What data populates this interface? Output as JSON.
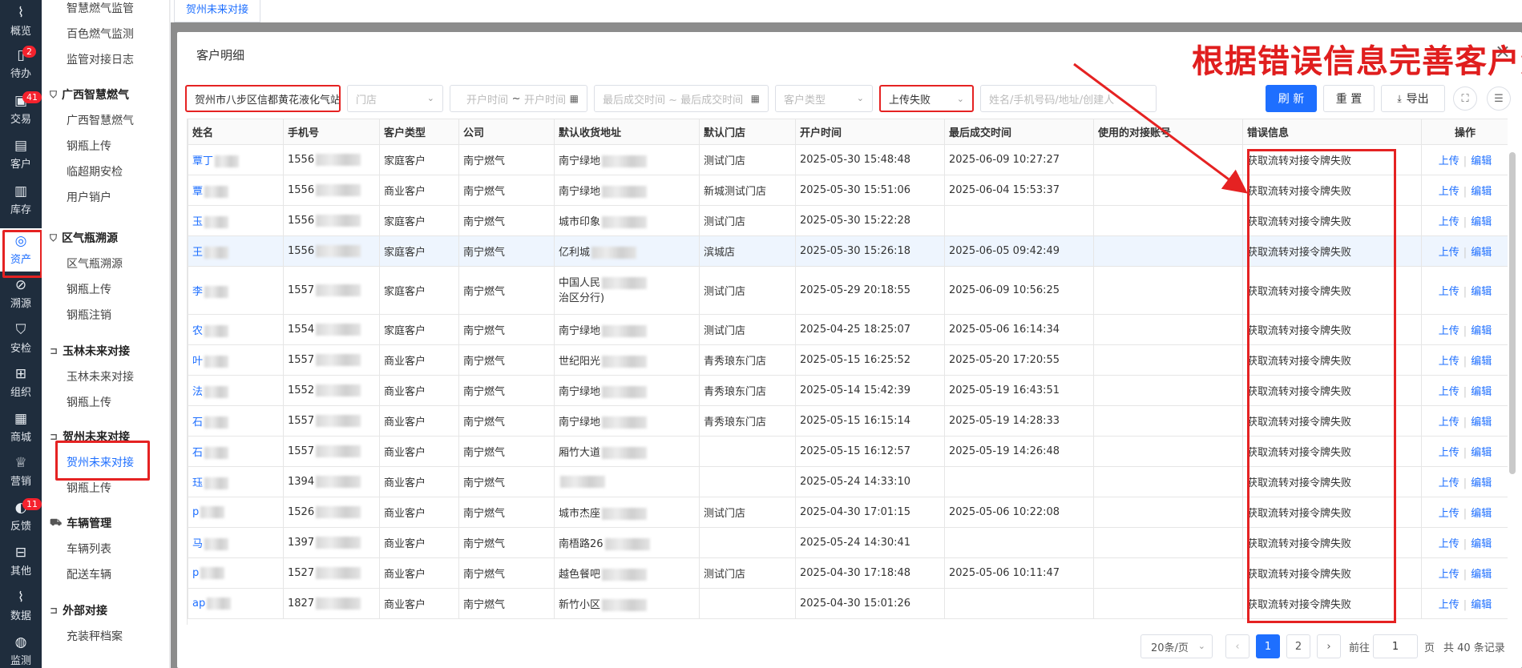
{
  "rail": [
    {
      "label": "概览",
      "icon": "chart-icon"
    },
    {
      "label": "待办",
      "icon": "todo-icon",
      "badge": "2"
    },
    {
      "label": "交易",
      "icon": "trade-icon",
      "badge": "41"
    },
    {
      "label": "客户",
      "icon": "customer-icon"
    },
    {
      "label": "库存",
      "icon": "inventory-icon"
    },
    {
      "label": "资产",
      "icon": "bulb-icon",
      "active": true
    },
    {
      "label": "溯源",
      "icon": "compass-icon"
    },
    {
      "label": "安检",
      "icon": "shield-icon"
    },
    {
      "label": "组织",
      "icon": "org-icon"
    },
    {
      "label": "商城",
      "icon": "shop-icon"
    },
    {
      "label": "营销",
      "icon": "trophy-icon"
    },
    {
      "label": "反馈",
      "icon": "feedback-icon",
      "badge": "11"
    },
    {
      "label": "其他",
      "icon": "grid-icon"
    },
    {
      "label": "数据",
      "icon": "data-icon"
    },
    {
      "label": "监测",
      "icon": "monitor-icon"
    }
  ],
  "submenu": {
    "top_items": [
      "智慧燃气监管",
      "百色燃气监测",
      "监管对接日志"
    ],
    "groups": [
      {
        "title": "广西智慧燃气",
        "items": [
          "广西智慧燃气",
          "钢瓶上传",
          "临超期安检",
          "用户销户"
        ]
      },
      {
        "title": "区气瓶溯源",
        "items": [
          "区气瓶溯源",
          "钢瓶上传",
          "钢瓶注销"
        ]
      },
      {
        "title": "玉林未来对接",
        "items": [
          "玉林未来对接",
          "钢瓶上传"
        ]
      },
      {
        "title": "贺州未来对接",
        "items": [
          "贺州未来对接",
          "钢瓶上传"
        ]
      },
      {
        "title": "车辆管理",
        "items": [
          "车辆列表",
          "配送车辆"
        ]
      },
      {
        "title": "外部对接",
        "items": [
          "充装秤档案"
        ]
      }
    ]
  },
  "tabbar": {
    "active_tab": "贺州未来对接"
  },
  "modal": {
    "title": "客户明细",
    "close": "×",
    "annotation": "根据错误信息完善客户资料"
  },
  "filters": {
    "station": "贺州市八步区信都黄花液化气站",
    "store_placeholder": "门店",
    "open_start": "开户时间",
    "range_sep": "~",
    "open_end": "开户时间",
    "last_deal": "最后成交时间 ~ 最后成交时间",
    "customer_type": "客户类型",
    "upload_status": "上传失败",
    "search_placeholder": "姓名/手机号码/地址/创建人",
    "refresh": "刷 新",
    "reset": "重 置",
    "export": "导出"
  },
  "table": {
    "headers": [
      "姓名",
      "手机号",
      "客户类型",
      "公司",
      "默认收货地址",
      "默认门店",
      "开户时间",
      "最后成交时间",
      "使用的对接账号",
      "错误信息",
      "操作"
    ],
    "rows": [
      {
        "name": "覃丁",
        "phone": "1556",
        "type": "家庭客户",
        "company": "南宁燃气",
        "address": "南宁绿地",
        "store": "测试门店",
        "open": "2025-05-30 15:48:48",
        "last": "2025-06-09 10:27:27",
        "account": "",
        "error": "获取流转对接令牌失败"
      },
      {
        "name": "覃",
        "phone": "1556",
        "type": "商业客户",
        "company": "南宁燃气",
        "address": "南宁绿地",
        "store": "新城测试门店",
        "open": "2025-05-30 15:51:06",
        "last": "2025-06-04 15:53:37",
        "account": "",
        "error": "获取流转对接令牌失败"
      },
      {
        "name": "玉",
        "phone": "1556",
        "type": "家庭客户",
        "company": "南宁燃气",
        "address": "城市印象",
        "store": "测试门店",
        "open": "2025-05-30 15:22:28",
        "last": "",
        "account": "",
        "error": "获取流转对接令牌失败"
      },
      {
        "name": "王",
        "phone": "1556",
        "type": "家庭客户",
        "company": "南宁燃气",
        "address": "亿利城",
        "store": "滨城店",
        "open": "2025-05-30 15:26:18",
        "last": "2025-06-05 09:42:49",
        "account": "",
        "error": "获取流转对接令牌失败"
      },
      {
        "name": "李",
        "phone": "1557",
        "type": "家庭客户",
        "company": "南宁燃气",
        "address": "中国人民",
        "address2": "治区分行)",
        "store": "测试门店",
        "open": "2025-05-29 20:18:55",
        "last": "2025-06-09 10:56:25",
        "account": "",
        "error": "获取流转对接令牌失败"
      },
      {
        "name": "农",
        "phone": "1554",
        "type": "家庭客户",
        "company": "南宁燃气",
        "address": "南宁绿地",
        "store": "测试门店",
        "open": "2025-04-25 18:25:07",
        "last": "2025-05-06 16:14:34",
        "account": "",
        "error": "获取流转对接令牌失败"
      },
      {
        "name": "叶",
        "phone": "1557",
        "type": "商业客户",
        "company": "南宁燃气",
        "address": "世纪阳光",
        "store": "青秀琅东门店",
        "open": "2025-05-15 16:25:52",
        "last": "2025-05-20 17:20:55",
        "account": "",
        "error": "获取流转对接令牌失败"
      },
      {
        "name": "法",
        "phone": "1552",
        "type": "商业客户",
        "company": "南宁燃气",
        "address": "南宁绿地",
        "store": "青秀琅东门店",
        "open": "2025-05-14 15:42:39",
        "last": "2025-05-19 16:43:51",
        "account": "",
        "error": "获取流转对接令牌失败"
      },
      {
        "name": "石",
        "phone": "1557",
        "type": "商业客户",
        "company": "南宁燃气",
        "address": "南宁绿地",
        "store": "青秀琅东门店",
        "open": "2025-05-15 16:15:14",
        "last": "2025-05-19 14:28:33",
        "account": "",
        "error": "获取流转对接令牌失败"
      },
      {
        "name": "石",
        "phone": "1557",
        "type": "商业客户",
        "company": "南宁燃气",
        "address": "厢竹大道",
        "store": "",
        "open": "2025-05-15 16:12:57",
        "last": "2025-05-19 14:26:48",
        "account": "",
        "error": "获取流转对接令牌失败"
      },
      {
        "name": "珏",
        "phone": "1394",
        "type": "商业客户",
        "company": "南宁燃气",
        "address": "",
        "store": "",
        "open": "2025-05-24 14:33:10",
        "last": "",
        "account": "",
        "error": "获取流转对接令牌失败"
      },
      {
        "name": "p",
        "phone": "1526",
        "type": "商业客户",
        "company": "南宁燃气",
        "address": "城市杰座",
        "store": "测试门店",
        "open": "2025-04-30 17:01:15",
        "last": "2025-05-06 10:22:08",
        "account": "",
        "error": "获取流转对接令牌失败"
      },
      {
        "name": "马",
        "phone": "1397",
        "type": "商业客户",
        "company": "南宁燃气",
        "address": "南梧路26",
        "store": "",
        "open": "2025-05-24 14:30:41",
        "last": "",
        "account": "",
        "error": "获取流转对接令牌失败"
      },
      {
        "name": "p",
        "phone": "1527",
        "type": "商业客户",
        "company": "南宁燃气",
        "address": "越色餐吧",
        "store": "测试门店",
        "open": "2025-04-30 17:18:48",
        "last": "2025-05-06 10:11:47",
        "account": "",
        "error": "获取流转对接令牌失败"
      },
      {
        "name": "ap",
        "phone": "1827",
        "type": "商业客户",
        "company": "南宁燃气",
        "address": "新竹小区",
        "store": "",
        "open": "2025-04-30 15:01:26",
        "last": "",
        "account": "",
        "error": "获取流转对接令牌失败"
      }
    ],
    "op_upload": "上传",
    "op_edit": "编辑"
  },
  "pagination": {
    "page_size": "20条/页",
    "pages": [
      "1",
      "2"
    ],
    "goto_label": "前往",
    "goto_value": "1",
    "page_unit": "页",
    "total": "共 40 条记录"
  },
  "colors": {
    "primary": "#1e6fff",
    "annotation": "#e01e1e",
    "rail": "#1f2d3d"
  }
}
